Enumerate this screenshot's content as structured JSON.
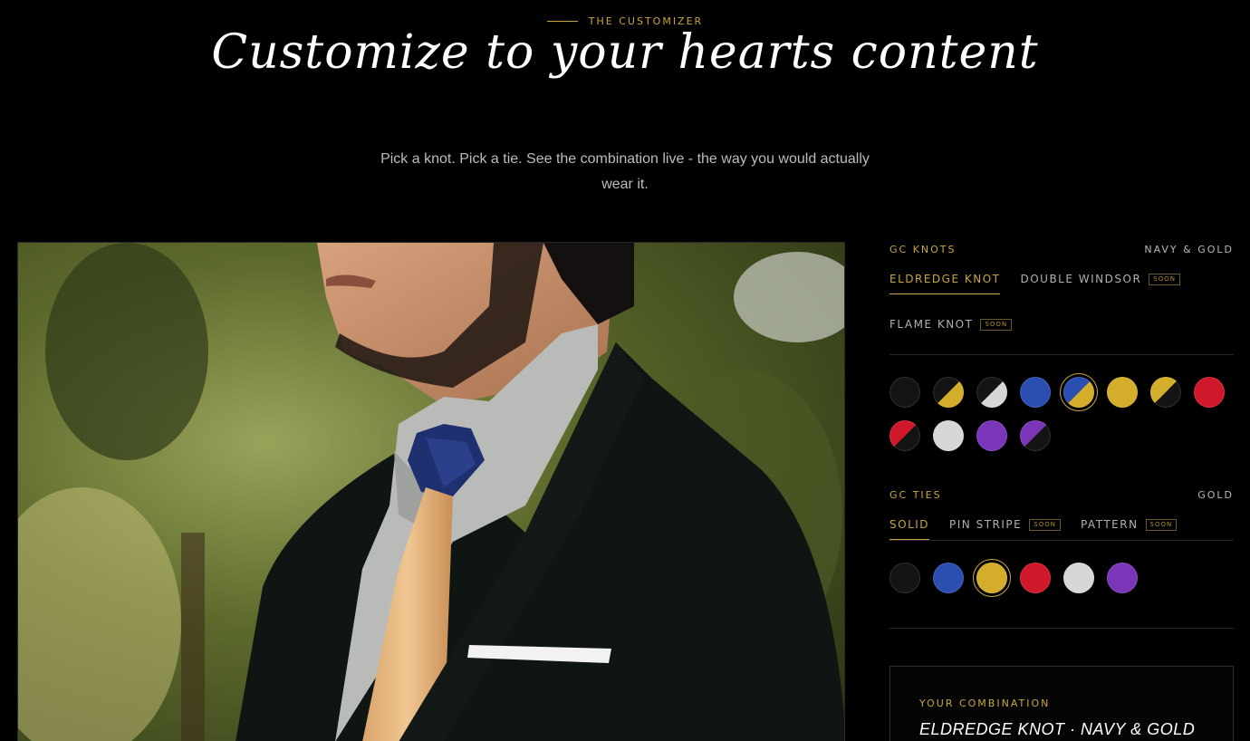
{
  "header": {
    "eyebrow": "THE CUSTOMIZER",
    "title": "Customize to your hearts content",
    "subtitle": "Pick a knot. Pick a tie. See the combination live - the way you would actually wear it."
  },
  "knots": {
    "label": "GC KNOTS",
    "selected_color": "NAVY & GOLD",
    "tabs": [
      {
        "label": "ELDREDGE KNOT",
        "badge": ""
      },
      {
        "label": "DOUBLE WINDSOR",
        "badge": "SOON"
      },
      {
        "label": "FLAME KNOT",
        "badge": "SOON"
      }
    ],
    "swatches": [
      {
        "name": "black",
        "c1": "#141414",
        "c2": "#141414"
      },
      {
        "name": "black-gold",
        "c1": "#141414",
        "c2": "#d4ad2a"
      },
      {
        "name": "black-silver",
        "c1": "#141414",
        "c2": "#d6d6d6"
      },
      {
        "name": "navy",
        "c1": "#2a4fb0",
        "c2": "#2a4fb0"
      },
      {
        "name": "navy-gold",
        "c1": "#2a4fb0",
        "c2": "#d4ad2a",
        "selected": true
      },
      {
        "name": "gold",
        "c1": "#d4ad2a",
        "c2": "#d4ad2a"
      },
      {
        "name": "gold-black",
        "c1": "#d4ad2a",
        "c2": "#141414"
      },
      {
        "name": "red",
        "c1": "#d0182a",
        "c2": "#d0182a"
      },
      {
        "name": "red-black",
        "c1": "#d0182a",
        "c2": "#141414"
      },
      {
        "name": "silver",
        "c1": "#d6d6d6",
        "c2": "#d6d6d6"
      },
      {
        "name": "purple",
        "c1": "#7a35b8",
        "c2": "#7a35b8"
      },
      {
        "name": "purple-black",
        "c1": "#7a35b8",
        "c2": "#141414"
      }
    ]
  },
  "ties": {
    "label": "GC TIES",
    "selected_color": "GOLD",
    "tabs": [
      {
        "label": "SOLID",
        "badge": ""
      },
      {
        "label": "PIN STRIPE",
        "badge": "SOON"
      },
      {
        "label": "PATTERN",
        "badge": "SOON"
      }
    ],
    "swatches": [
      {
        "name": "black",
        "c1": "#141414",
        "c2": "#141414"
      },
      {
        "name": "navy",
        "c1": "#2a4fb0",
        "c2": "#2a4fb0"
      },
      {
        "name": "gold",
        "c1": "#d4ad2a",
        "c2": "#d4ad2a",
        "selected": true
      },
      {
        "name": "red",
        "c1": "#d0182a",
        "c2": "#d0182a"
      },
      {
        "name": "silver",
        "c1": "#d6d6d6",
        "c2": "#d6d6d6"
      },
      {
        "name": "purple",
        "c1": "#7a35b8",
        "c2": "#7a35b8"
      }
    ]
  },
  "combination": {
    "label": "YOUR COMBINATION",
    "value": "ELDREDGE KNOT · NAVY & GOLD"
  },
  "colors": {
    "accent": "#c9a640",
    "background": "#000000"
  }
}
